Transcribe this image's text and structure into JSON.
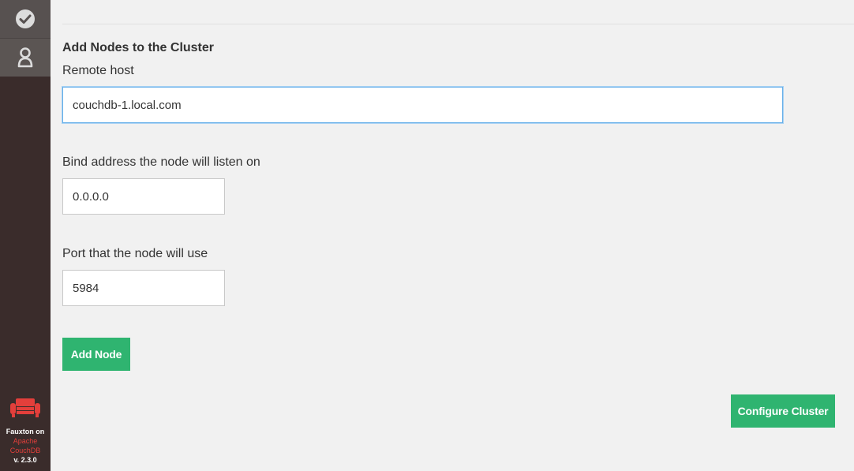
{
  "sidebar": {
    "items": [
      {
        "name": "checkmark-icon"
      },
      {
        "name": "user-icon"
      }
    ],
    "brand": {
      "line1": "Fauxton on",
      "line2": "Apache",
      "line3": "CouchDB",
      "version": "v. 2.3.0"
    },
    "colors": {
      "background": "#3a2c2b",
      "accent": "#e33f3b"
    }
  },
  "form": {
    "heading": "Add Nodes to the Cluster",
    "remote_host": {
      "label": "Remote host",
      "value": "couchdb-1.local.com"
    },
    "bind_address": {
      "label": "Bind address the node will listen on",
      "value": "0.0.0.0"
    },
    "port": {
      "label": "Port that the node will use",
      "value": "5984"
    },
    "add_node_label": "Add Node",
    "configure_cluster_label": "Configure Cluster",
    "button_color": "#2fb470"
  }
}
